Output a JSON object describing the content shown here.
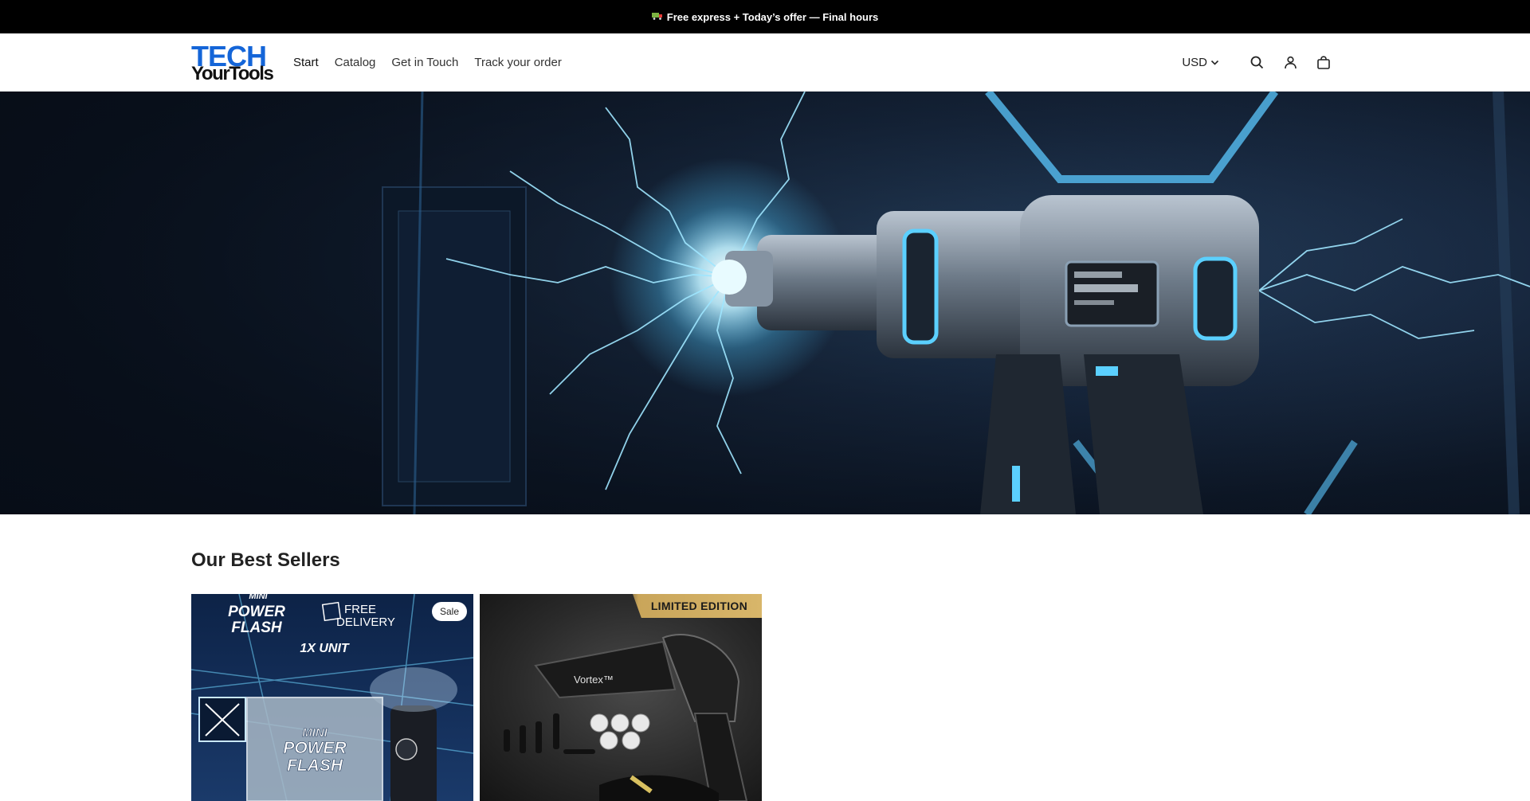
{
  "announcement": {
    "icon": "truck-icon",
    "text": "Free express + Today’s offer — Final hours"
  },
  "header": {
    "logo": {
      "line1": "TECH",
      "line2": "YourTools"
    },
    "nav": [
      "Start",
      "Catalog",
      "Get in Touch",
      "Track your order"
    ],
    "currency": "USD",
    "icons": [
      "search-icon",
      "account-icon",
      "cart-icon"
    ]
  },
  "hero": {
    "image_subject": "power-tool-lightning-banner"
  },
  "best_sellers": {
    "title": "Our Best Sellers",
    "products": [
      {
        "badge": "Sale",
        "image_text": {
          "line1": "MINI",
          "line2": "POWER",
          "line3": "FLASH",
          "delivery1": "FREE",
          "delivery2": "DELIVERY",
          "units": "1X UNIT",
          "box1": "MINI",
          "box2": "POWER",
          "box3": "FLASH"
        }
      },
      {
        "ribbon": "LIMITED EDITION",
        "image_text": {
          "brand": "Vortex™"
        }
      }
    ]
  },
  "colors": {
    "announcement_bg": "#000000",
    "logo_blue": "#1465d8",
    "ribbon_gold": "#d2b064",
    "hero_glow": "#6fd6ff"
  }
}
